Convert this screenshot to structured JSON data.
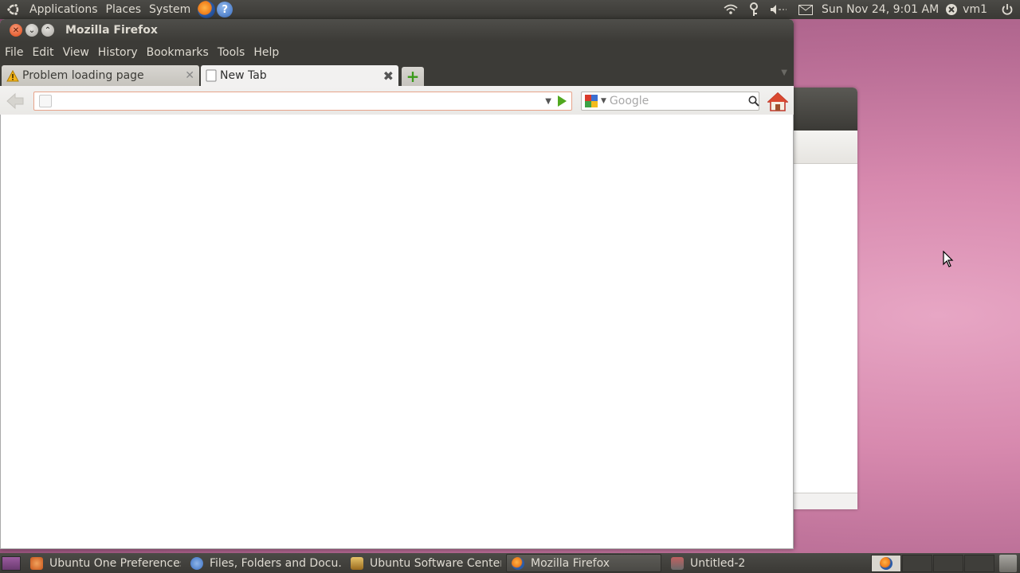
{
  "top_panel": {
    "menus": [
      "Applications",
      "Places",
      "System"
    ],
    "clock": "Sun Nov 24,  9:01 AM",
    "user": "vm1"
  },
  "window": {
    "title": "Mozilla Firefox",
    "menu": [
      "File",
      "Edit",
      "View",
      "History",
      "Bookmarks",
      "Tools",
      "Help"
    ],
    "tabs": [
      {
        "label": "Problem loading page",
        "state": "inactive",
        "icon": "warning-icon"
      },
      {
        "label": "New Tab",
        "state": "active",
        "icon": "blank-page-icon"
      }
    ],
    "url": {
      "value": "",
      "placeholder": ""
    },
    "search": {
      "placeholder": "Google",
      "engine_icon": "google-icon"
    }
  },
  "taskbar": {
    "tasks": [
      {
        "label": "Ubuntu One Preferences",
        "icon": "ubuntu-one-icon",
        "active": false
      },
      {
        "label": "Files, Folders and Docu...",
        "icon": "help-icon",
        "active": false
      },
      {
        "label": "Ubuntu Software Center",
        "icon": "software-center-icon",
        "active": false
      },
      {
        "label": "Mozilla Firefox",
        "icon": "firefox-icon",
        "active": true
      },
      {
        "label": "Untitled-2",
        "icon": "gimp-icon",
        "active": false
      }
    ]
  },
  "colors": {
    "panel": "#3c3b37",
    "desktop": "#c878a0",
    "accent_close": "#df4a16",
    "go_green": "#51a81f"
  }
}
